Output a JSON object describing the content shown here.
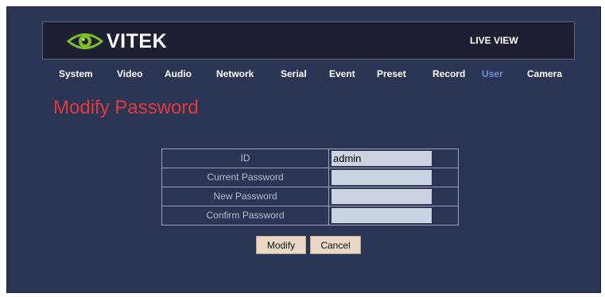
{
  "header": {
    "brand": "VITEK",
    "live_view": "LIVE VIEW",
    "logo_icon": "eye-icon",
    "colors": {
      "logo_green": "#7fbf2a",
      "background": "#2b3555",
      "header_bg": "#1d2033"
    }
  },
  "nav": {
    "items": [
      {
        "label": "System",
        "active": false
      },
      {
        "label": "Video",
        "active": false
      },
      {
        "label": "Audio",
        "active": false
      },
      {
        "label": "Network",
        "active": false
      },
      {
        "label": "Serial",
        "active": false
      },
      {
        "label": "Event",
        "active": false
      },
      {
        "label": "Preset",
        "active": false
      },
      {
        "label": "Record",
        "active": false
      },
      {
        "label": "User",
        "active": true
      },
      {
        "label": "Camera",
        "active": false
      }
    ],
    "active_color": "#6f8fd6"
  },
  "page": {
    "title": "Modify Password",
    "title_color": "#e23b3b"
  },
  "form": {
    "rows": [
      {
        "label": "ID",
        "value": "admin"
      },
      {
        "label": "Current Password",
        "value": ""
      },
      {
        "label": "New Password",
        "value": ""
      },
      {
        "label": "Confirm Password",
        "value": ""
      }
    ],
    "modify_label": "Modify",
    "cancel_label": "Cancel"
  }
}
